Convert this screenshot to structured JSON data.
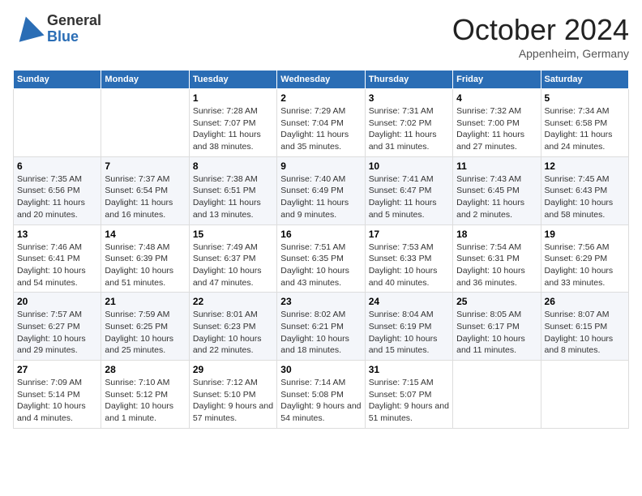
{
  "header": {
    "logo": {
      "general": "General",
      "blue": "Blue"
    },
    "title": "October 2024",
    "location": "Appenheim, Germany"
  },
  "weekdays": [
    "Sunday",
    "Monday",
    "Tuesday",
    "Wednesday",
    "Thursday",
    "Friday",
    "Saturday"
  ],
  "weeks": [
    [
      {
        "day": "",
        "empty": true
      },
      {
        "day": "",
        "empty": true
      },
      {
        "day": "1",
        "sunrise": "Sunrise: 7:28 AM",
        "sunset": "Sunset: 7:07 PM",
        "daylight": "Daylight: 11 hours and 38 minutes."
      },
      {
        "day": "2",
        "sunrise": "Sunrise: 7:29 AM",
        "sunset": "Sunset: 7:04 PM",
        "daylight": "Daylight: 11 hours and 35 minutes."
      },
      {
        "day": "3",
        "sunrise": "Sunrise: 7:31 AM",
        "sunset": "Sunset: 7:02 PM",
        "daylight": "Daylight: 11 hours and 31 minutes."
      },
      {
        "day": "4",
        "sunrise": "Sunrise: 7:32 AM",
        "sunset": "Sunset: 7:00 PM",
        "daylight": "Daylight: 11 hours and 27 minutes."
      },
      {
        "day": "5",
        "sunrise": "Sunrise: 7:34 AM",
        "sunset": "Sunset: 6:58 PM",
        "daylight": "Daylight: 11 hours and 24 minutes."
      }
    ],
    [
      {
        "day": "6",
        "sunrise": "Sunrise: 7:35 AM",
        "sunset": "Sunset: 6:56 PM",
        "daylight": "Daylight: 11 hours and 20 minutes."
      },
      {
        "day": "7",
        "sunrise": "Sunrise: 7:37 AM",
        "sunset": "Sunset: 6:54 PM",
        "daylight": "Daylight: 11 hours and 16 minutes."
      },
      {
        "day": "8",
        "sunrise": "Sunrise: 7:38 AM",
        "sunset": "Sunset: 6:51 PM",
        "daylight": "Daylight: 11 hours and 13 minutes."
      },
      {
        "day": "9",
        "sunrise": "Sunrise: 7:40 AM",
        "sunset": "Sunset: 6:49 PM",
        "daylight": "Daylight: 11 hours and 9 minutes."
      },
      {
        "day": "10",
        "sunrise": "Sunrise: 7:41 AM",
        "sunset": "Sunset: 6:47 PM",
        "daylight": "Daylight: 11 hours and 5 minutes."
      },
      {
        "day": "11",
        "sunrise": "Sunrise: 7:43 AM",
        "sunset": "Sunset: 6:45 PM",
        "daylight": "Daylight: 11 hours and 2 minutes."
      },
      {
        "day": "12",
        "sunrise": "Sunrise: 7:45 AM",
        "sunset": "Sunset: 6:43 PM",
        "daylight": "Daylight: 10 hours and 58 minutes."
      }
    ],
    [
      {
        "day": "13",
        "sunrise": "Sunrise: 7:46 AM",
        "sunset": "Sunset: 6:41 PM",
        "daylight": "Daylight: 10 hours and 54 minutes."
      },
      {
        "day": "14",
        "sunrise": "Sunrise: 7:48 AM",
        "sunset": "Sunset: 6:39 PM",
        "daylight": "Daylight: 10 hours and 51 minutes."
      },
      {
        "day": "15",
        "sunrise": "Sunrise: 7:49 AM",
        "sunset": "Sunset: 6:37 PM",
        "daylight": "Daylight: 10 hours and 47 minutes."
      },
      {
        "day": "16",
        "sunrise": "Sunrise: 7:51 AM",
        "sunset": "Sunset: 6:35 PM",
        "daylight": "Daylight: 10 hours and 43 minutes."
      },
      {
        "day": "17",
        "sunrise": "Sunrise: 7:53 AM",
        "sunset": "Sunset: 6:33 PM",
        "daylight": "Daylight: 10 hours and 40 minutes."
      },
      {
        "day": "18",
        "sunrise": "Sunrise: 7:54 AM",
        "sunset": "Sunset: 6:31 PM",
        "daylight": "Daylight: 10 hours and 36 minutes."
      },
      {
        "day": "19",
        "sunrise": "Sunrise: 7:56 AM",
        "sunset": "Sunset: 6:29 PM",
        "daylight": "Daylight: 10 hours and 33 minutes."
      }
    ],
    [
      {
        "day": "20",
        "sunrise": "Sunrise: 7:57 AM",
        "sunset": "Sunset: 6:27 PM",
        "daylight": "Daylight: 10 hours and 29 minutes."
      },
      {
        "day": "21",
        "sunrise": "Sunrise: 7:59 AM",
        "sunset": "Sunset: 6:25 PM",
        "daylight": "Daylight: 10 hours and 25 minutes."
      },
      {
        "day": "22",
        "sunrise": "Sunrise: 8:01 AM",
        "sunset": "Sunset: 6:23 PM",
        "daylight": "Daylight: 10 hours and 22 minutes."
      },
      {
        "day": "23",
        "sunrise": "Sunrise: 8:02 AM",
        "sunset": "Sunset: 6:21 PM",
        "daylight": "Daylight: 10 hours and 18 minutes."
      },
      {
        "day": "24",
        "sunrise": "Sunrise: 8:04 AM",
        "sunset": "Sunset: 6:19 PM",
        "daylight": "Daylight: 10 hours and 15 minutes."
      },
      {
        "day": "25",
        "sunrise": "Sunrise: 8:05 AM",
        "sunset": "Sunset: 6:17 PM",
        "daylight": "Daylight: 10 hours and 11 minutes."
      },
      {
        "day": "26",
        "sunrise": "Sunrise: 8:07 AM",
        "sunset": "Sunset: 6:15 PM",
        "daylight": "Daylight: 10 hours and 8 minutes."
      }
    ],
    [
      {
        "day": "27",
        "sunrise": "Sunrise: 7:09 AM",
        "sunset": "Sunset: 5:14 PM",
        "daylight": "Daylight: 10 hours and 4 minutes."
      },
      {
        "day": "28",
        "sunrise": "Sunrise: 7:10 AM",
        "sunset": "Sunset: 5:12 PM",
        "daylight": "Daylight: 10 hours and 1 minute."
      },
      {
        "day": "29",
        "sunrise": "Sunrise: 7:12 AM",
        "sunset": "Sunset: 5:10 PM",
        "daylight": "Daylight: 9 hours and 57 minutes."
      },
      {
        "day": "30",
        "sunrise": "Sunrise: 7:14 AM",
        "sunset": "Sunset: 5:08 PM",
        "daylight": "Daylight: 9 hours and 54 minutes."
      },
      {
        "day": "31",
        "sunrise": "Sunrise: 7:15 AM",
        "sunset": "Sunset: 5:07 PM",
        "daylight": "Daylight: 9 hours and 51 minutes."
      },
      {
        "day": "",
        "empty": true
      },
      {
        "day": "",
        "empty": true
      }
    ]
  ]
}
